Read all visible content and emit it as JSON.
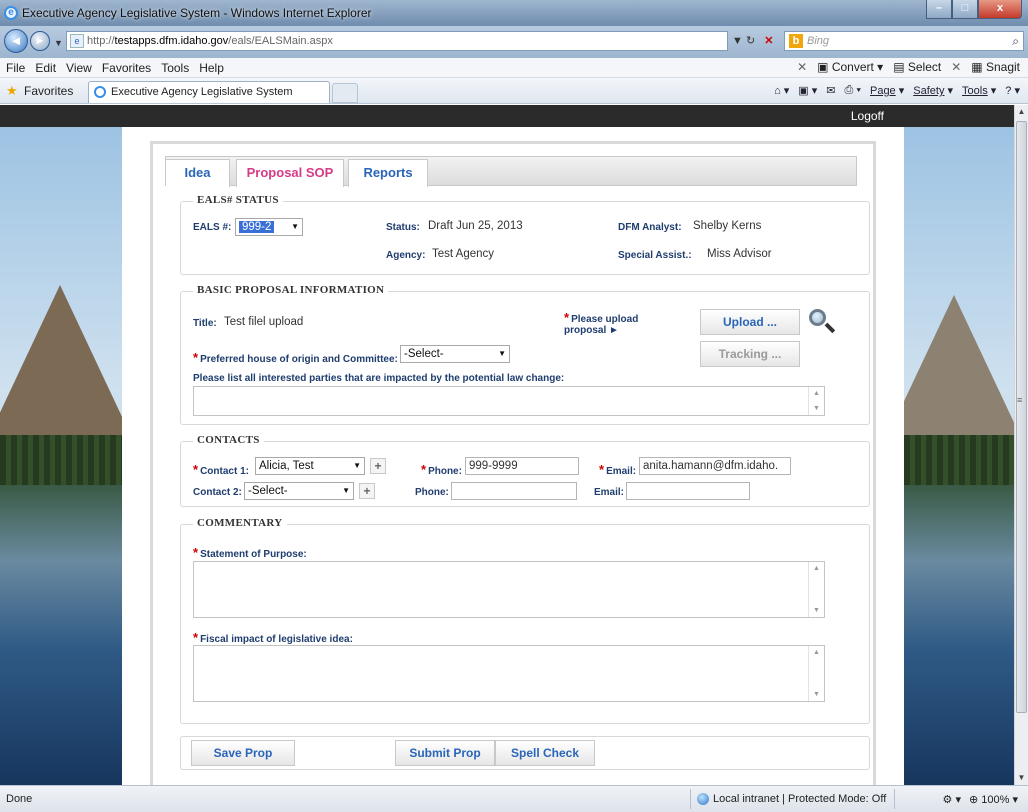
{
  "window": {
    "title": "Executive Agency Legislative System - Windows Internet Explorer",
    "minimize": "–",
    "maximize": "□",
    "close": "x"
  },
  "address": {
    "url_prefix": "http://",
    "host": "testapps.dfm.idaho.gov",
    "path": "/eals/EALSMain.aspx",
    "search_placeholder": "Bing"
  },
  "menu": {
    "items": [
      "File",
      "Edit",
      "View",
      "Favorites",
      "Tools",
      "Help"
    ],
    "convert": "Convert",
    "select": "Select",
    "snagit": "Snagit"
  },
  "favorites": {
    "label": "Favorites",
    "tab_title": "Executive Agency Legislative System",
    "commands": [
      "Page",
      "Safety",
      "Tools"
    ]
  },
  "app": {
    "logoff": "Logoff",
    "tabs": [
      {
        "label": "Idea",
        "active": false
      },
      {
        "label": "Proposal SOP",
        "active": true
      },
      {
        "label": "Reports",
        "active": false
      }
    ]
  },
  "status_section": {
    "legend": "EALS# STATUS",
    "eals_label": "EALS #:",
    "eals_value": "999-2",
    "status_label": "Status:",
    "status_value": "Draft  Jun 25, 2013",
    "agency_label": "Agency:",
    "agency_value": "Test Agency",
    "analyst_label": "DFM Analyst:",
    "analyst_value": "Shelby Kerns",
    "assist_label": "Special Assist.:",
    "assist_value": "Miss Advisor"
  },
  "basic_section": {
    "legend": "BASIC PROPOSAL INFORMATION",
    "title_label": "Title:",
    "title_value": "Test filel upload",
    "upload_note": "Please upload proposal ►",
    "upload_button": "Upload ...",
    "tracking_button": "Tracking ...",
    "house_label": "Preferred house of origin and Committee:",
    "house_value": "-Select-",
    "parties_label": "Please list all interested parties that are impacted by the potential law change:"
  },
  "contacts_section": {
    "legend": "CONTACTS",
    "contact1_label": "Contact 1:",
    "contact1_value": "Alicia, Test",
    "contact2_label": "Contact 2:",
    "contact2_value": "-Select-",
    "phone_label": "Phone:",
    "phone1_value": "999-9999",
    "phone2_value": "",
    "email_label": "Email:",
    "email1_value": "anita.hamann@dfm.idaho.",
    "email2_value": ""
  },
  "commentary_section": {
    "legend": "COMMENTARY",
    "sop_label": "Statement of Purpose:",
    "fiscal_label": "Fiscal impact of legislative idea:"
  },
  "actions": {
    "save": "Save Prop",
    "submit": "Submit Prop",
    "spell": "Spell Check"
  },
  "statusbar": {
    "done": "Done",
    "zone": "Local intranet | Protected Mode: Off",
    "zoom": "100%"
  }
}
